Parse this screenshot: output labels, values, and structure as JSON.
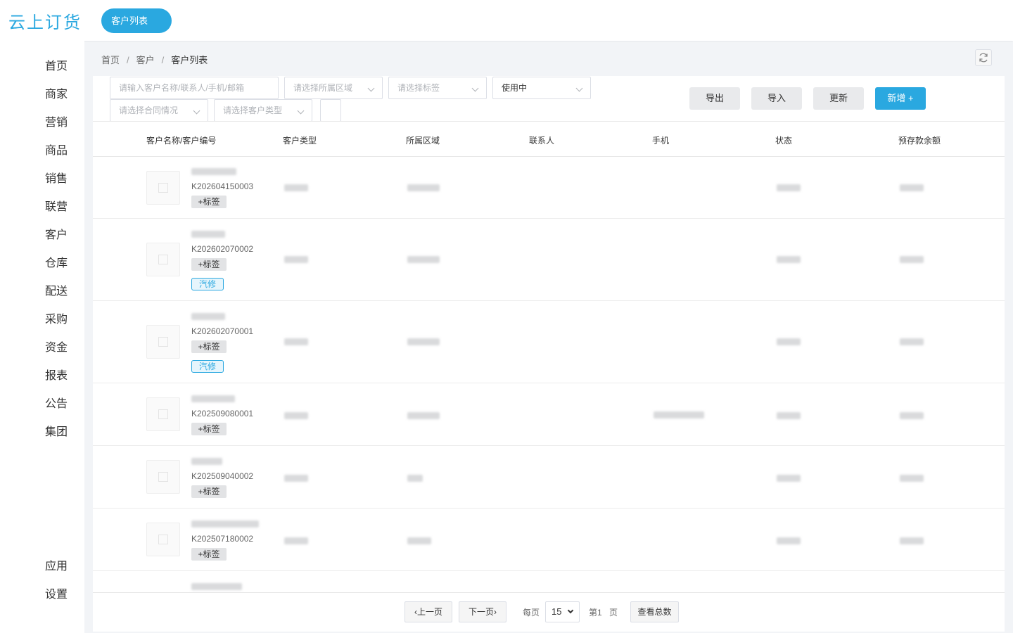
{
  "header": {
    "logo": "云上订货",
    "active_tab": "客户列表"
  },
  "sidebar": {
    "items": [
      "首页",
      "商家",
      "营销",
      "商品",
      "销售",
      "联营",
      "客户",
      "仓库",
      "配送",
      "采购",
      "资金",
      "报表",
      "公告",
      "集团"
    ],
    "bottom": [
      "应用",
      "设置"
    ]
  },
  "breadcrumb": {
    "home": "首页",
    "section": "客户",
    "current": "客户列表",
    "sep": "/"
  },
  "filters": {
    "search_placeholder": "请输入客户名称/联系人/手机/邮箱",
    "region_placeholder": "请选择所属区域",
    "tag_placeholder": "请选择标签",
    "status_value": "使用中",
    "contract_placeholder": "请选择合同情况",
    "type_placeholder": "请选择客户类型"
  },
  "actions": {
    "export": "导出",
    "import": "导入",
    "update": "更新",
    "add": "新增 +"
  },
  "table": {
    "columns": [
      "客户名称/客户编号",
      "客户类型",
      "所属区域",
      "联系人",
      "手机",
      "状态",
      "预存款余额"
    ],
    "rows": [
      {
        "code": "K202604150003",
        "tag_button": "+标签",
        "chip": ""
      },
      {
        "code": "K202602070002",
        "tag_button": "+标签",
        "chip": "汽修"
      },
      {
        "code": "K202602070001",
        "tag_button": "+标签",
        "chip": "汽修"
      },
      {
        "code": "K202509080001",
        "tag_button": "+标签",
        "chip": ""
      },
      {
        "code": "K202509040002",
        "tag_button": "+标签",
        "chip": ""
      },
      {
        "code": "K202507180002",
        "tag_button": "+标签",
        "chip": ""
      }
    ]
  },
  "pagination": {
    "prev": "上一页",
    "next": "下一页",
    "per_page_label": "每页",
    "per_page_value": "15",
    "page_label": "第1",
    "page_suffix": "页",
    "total_button": "查看总数"
  },
  "colors": {
    "accent": "#2aa8e0",
    "background": "#f2f4f7"
  }
}
